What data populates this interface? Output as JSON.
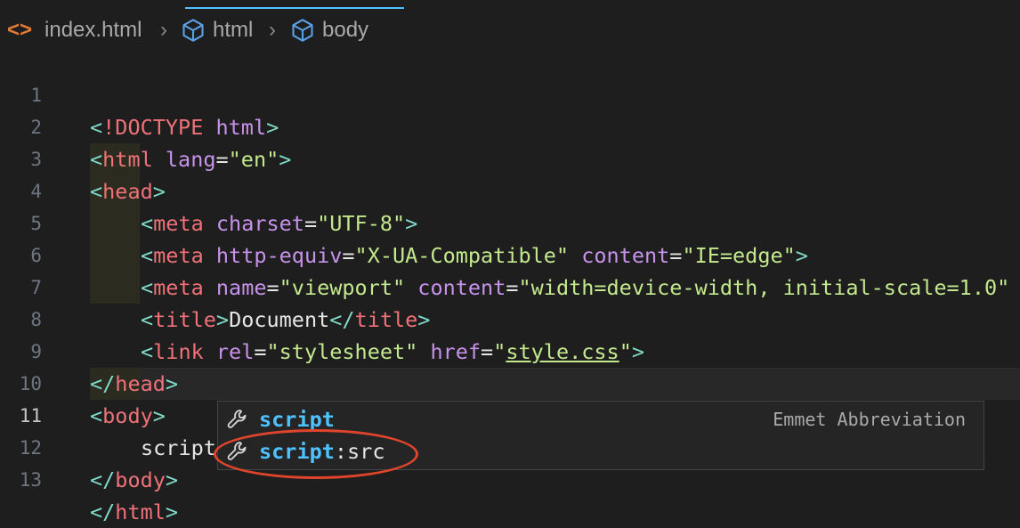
{
  "breadcrumb": {
    "file": "index.html",
    "items": [
      "html",
      "body"
    ]
  },
  "code": {
    "lines": [
      {
        "num": "1"
      },
      {
        "num": "2"
      },
      {
        "num": "3"
      },
      {
        "num": "4"
      },
      {
        "num": "5"
      },
      {
        "num": "6"
      },
      {
        "num": "7"
      },
      {
        "num": "8"
      },
      {
        "num": "9"
      },
      {
        "num": "10"
      },
      {
        "num": "11"
      },
      {
        "num": "12"
      },
      {
        "num": "13"
      }
    ],
    "typed": "script",
    "doctype": "<!DOCTYPE html>",
    "html_open": "html",
    "lang_attr": "lang",
    "lang_val": "\"en\"",
    "head": "head",
    "meta": "meta",
    "charset_attr": "charset",
    "charset_val": "\"UTF-8\"",
    "httpequiv_attr": "http-equiv",
    "httpequiv_val": "\"X-UA-Compatible\"",
    "content_attr": "content",
    "content_val1": "\"IE=edge\"",
    "name_attr": "name",
    "name_val": "\"viewport\"",
    "content_val2": "\"width=device-width, initial-scale=1.0\"",
    "title": "title",
    "title_text": "Document",
    "link": "link",
    "rel_attr": "rel",
    "rel_val": "\"stylesheet\"",
    "href_attr": "href",
    "href_val_q": "\"",
    "href_val": "style.css",
    "body": "body"
  },
  "suggestions": [
    {
      "match": "script",
      "rest": "",
      "detail": "Emmet Abbreviation"
    },
    {
      "match": "script",
      "rest": ":src",
      "detail": ""
    }
  ],
  "colors": {
    "accent": "#4fc1ff",
    "annotation": "#e0442b"
  },
  "icons": {
    "file": "html-file-icon",
    "breadcrumb": "cube-icon",
    "suggestion": "wrench-icon"
  }
}
